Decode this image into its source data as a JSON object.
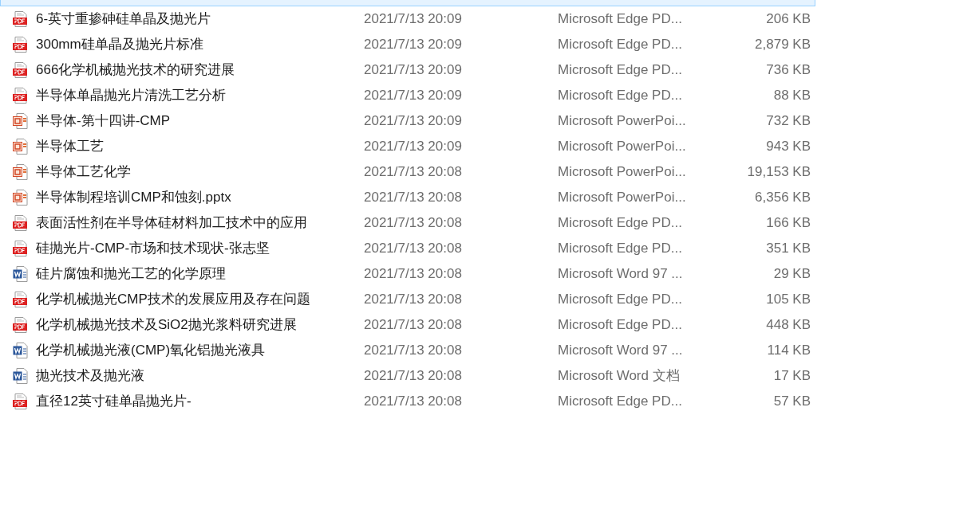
{
  "files": [
    {
      "name": "6-英寸重掺砷硅单晶及抛光片",
      "modified": "2021/7/13 20:09",
      "type": "Microsoft Edge PD...",
      "size": "206 KB",
      "kind": "pdf"
    },
    {
      "name": "300mm硅单晶及抛光片标准",
      "modified": "2021/7/13 20:09",
      "type": "Microsoft Edge PD...",
      "size": "2,879 KB",
      "kind": "pdf"
    },
    {
      "name": "666化学机械抛光技术的研究进展",
      "modified": "2021/7/13 20:09",
      "type": "Microsoft Edge PD...",
      "size": "736 KB",
      "kind": "pdf"
    },
    {
      "name": "半导体单晶抛光片清洗工艺分析",
      "modified": "2021/7/13 20:09",
      "type": "Microsoft Edge PD...",
      "size": "88 KB",
      "kind": "pdf"
    },
    {
      "name": "半导体-第十四讲-CMP",
      "modified": "2021/7/13 20:09",
      "type": "Microsoft PowerPoi...",
      "size": "732 KB",
      "kind": "ppt"
    },
    {
      "name": "半导体工艺",
      "modified": "2021/7/13 20:09",
      "type": "Microsoft PowerPoi...",
      "size": "943 KB",
      "kind": "ppt"
    },
    {
      "name": "半导体工艺化学",
      "modified": "2021/7/13 20:08",
      "type": "Microsoft PowerPoi...",
      "size": "19,153 KB",
      "kind": "ppt"
    },
    {
      "name": "半导体制程培训CMP和蚀刻.pptx",
      "modified": "2021/7/13 20:08",
      "type": "Microsoft PowerPoi...",
      "size": "6,356 KB",
      "kind": "ppt"
    },
    {
      "name": "表面活性剂在半导体硅材料加工技术中的应用",
      "modified": "2021/7/13 20:08",
      "type": "Microsoft Edge PD...",
      "size": "166 KB",
      "kind": "pdf"
    },
    {
      "name": "硅抛光片-CMP-市场和技术现状-张志坚",
      "modified": "2021/7/13 20:08",
      "type": "Microsoft Edge PD...",
      "size": "351 KB",
      "kind": "pdf"
    },
    {
      "name": "硅片腐蚀和抛光工艺的化学原理",
      "modified": "2021/7/13 20:08",
      "type": "Microsoft Word 97 ...",
      "size": "29 KB",
      "kind": "word"
    },
    {
      "name": "化学机械抛光CMP技术的发展应用及存在问题",
      "modified": "2021/7/13 20:08",
      "type": "Microsoft Edge PD...",
      "size": "105 KB",
      "kind": "pdf"
    },
    {
      "name": "化学机械抛光技术及SiO2抛光浆料研究进展",
      "modified": "2021/7/13 20:08",
      "type": "Microsoft Edge PD...",
      "size": "448 KB",
      "kind": "pdf"
    },
    {
      "name": "化学机械抛光液(CMP)氧化铝抛光液具",
      "modified": "2021/7/13 20:08",
      "type": "Microsoft Word 97 ...",
      "size": "114 KB",
      "kind": "word"
    },
    {
      "name": "抛光技术及抛光液",
      "modified": "2021/7/13 20:08",
      "type": "Microsoft Word 文档",
      "size": "17 KB",
      "kind": "word"
    },
    {
      "name": "直径12英寸硅单晶抛光片-",
      "modified": "2021/7/13 20:08",
      "type": "Microsoft Edge PD...",
      "size": "57 KB",
      "kind": "pdf"
    }
  ]
}
